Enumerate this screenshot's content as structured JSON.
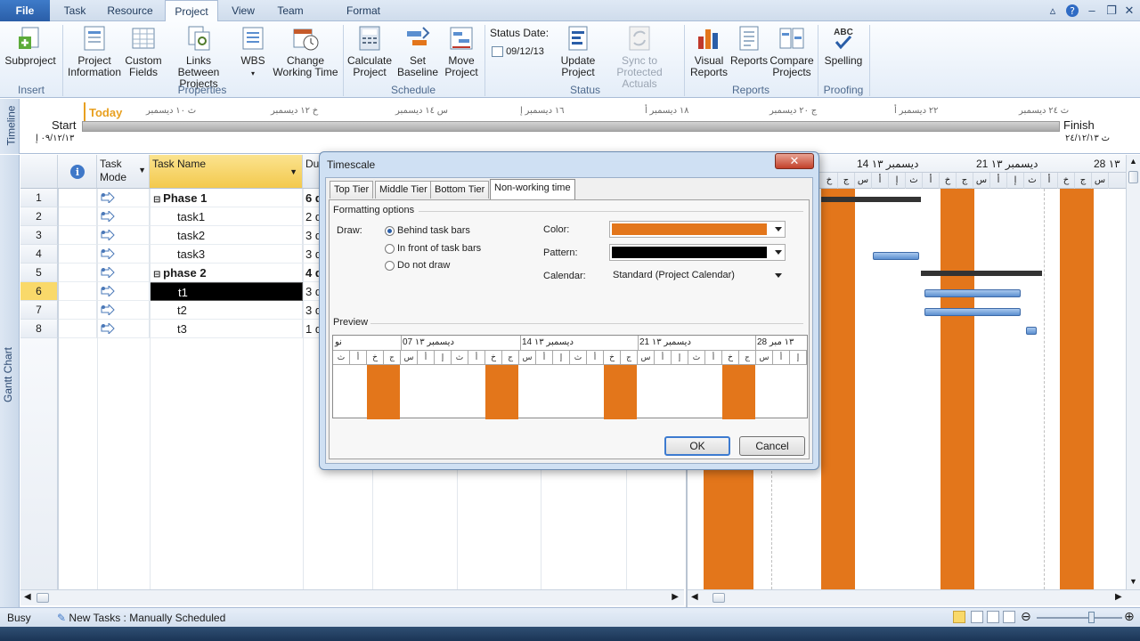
{
  "ribbon_tabs": [
    "File",
    "Task",
    "Resource",
    "Project",
    "View",
    "Team",
    "Format"
  ],
  "ribbon": {
    "insert": {
      "subproject": "Subproject",
      "group": "Insert"
    },
    "properties": {
      "project_info": "Project Information",
      "custom_fields": "Custom Fields",
      "links": "Links Between Projects",
      "wbs": "WBS",
      "change_working_time": "Change Working Time",
      "group": "Properties"
    },
    "schedule": {
      "calculate": "Calculate Project",
      "set_baseline": "Set Baseline",
      "move_project": "Move Project",
      "group": "Schedule"
    },
    "status": {
      "status_date_label": "Status Date:",
      "status_date": "09/12/13",
      "update_project": "Update Project",
      "sync": "Sync to Protected Actuals",
      "group": "Status"
    },
    "reports": {
      "visual_reports": "Visual Reports",
      "reports": "Reports",
      "compare": "Compare Projects",
      "group": "Reports"
    },
    "proofing": {
      "spelling": "Spelling",
      "group": "Proofing"
    }
  },
  "timeline": {
    "side_label": "Timeline",
    "today": "Today",
    "start_label": "Start",
    "start_date": "٠٩/١٢/١٣ إ",
    "finish_label": "Finish",
    "finish_date": "ث ٢٤/١٢/١٣",
    "ticks": [
      "ث ١٠ ديسمبر",
      "خ ١٢ ديسمبر",
      "س ١٤ ديسمبر",
      "١٦ ديسمبر إ",
      "١٨ ديسمبر أ",
      "ج ٢٠ ديسمبر",
      "٢٢ ديسمبر أ",
      "ث ٢٤ ديسمبر"
    ]
  },
  "gantt_side_label": "Gantt Chart",
  "table": {
    "headers": {
      "info": "i",
      "mode": "Task Mode",
      "name": "Task Name",
      "duration": "Du"
    },
    "rows": [
      {
        "id": "1",
        "name": "Phase 1",
        "dur": "6 d",
        "summary": true
      },
      {
        "id": "2",
        "name": "task1",
        "dur": "2 d",
        "summary": false
      },
      {
        "id": "3",
        "name": "task2",
        "dur": "3 d",
        "summary": false
      },
      {
        "id": "4",
        "name": "task3",
        "dur": "3 d",
        "summary": false
      },
      {
        "id": "5",
        "name": "phase 2",
        "dur": "4 d",
        "summary": true
      },
      {
        "id": "6",
        "name": "t1",
        "dur": "3 d",
        "summary": false,
        "selected": true
      },
      {
        "id": "7",
        "name": "t2",
        "dur": "3 d",
        "summary": false
      },
      {
        "id": "8",
        "name": "t3",
        "dur": "1 d",
        "summary": false
      }
    ]
  },
  "gantt": {
    "weeks": [
      "14 ديسمبر ١٣",
      "21 ديسمبر ١٣",
      "28 ١٣"
    ],
    "days": [
      "خ",
      "ج",
      "س",
      "أ",
      "إ",
      "ث",
      "أ",
      "خ",
      "ج",
      "س",
      "أ",
      "إ",
      "ث",
      "أ",
      "خ",
      "ج",
      "س"
    ]
  },
  "dialog": {
    "title": "Timescale",
    "close": "✕",
    "tabs": [
      "Top Tier",
      "Middle Tier",
      "Bottom Tier",
      "Non-working time"
    ],
    "formatting_options": "Formatting options",
    "draw_label": "Draw:",
    "draw_options": [
      "Behind task bars",
      "In front of task bars",
      "Do not draw"
    ],
    "color_label": "Color:",
    "color_value": "#e3761b",
    "pattern_label": "Pattern:",
    "calendar_label": "Calendar:",
    "calendar_value": "Standard (Project Calendar)",
    "preview_label": "Preview",
    "preview_weeks": [
      "نو",
      "07 ديسمبر ١٣",
      "14 ديسمبر ١٣",
      "21 ديسمبر ١٣",
      "28 ١٣ مبر"
    ],
    "preview_days": [
      "ث",
      "أ",
      "خ",
      "ج",
      "س",
      "أ",
      "إ",
      "ث",
      "أ",
      "خ",
      "ج",
      "س",
      "أ",
      "إ",
      "ث",
      "أ",
      "خ",
      "ج",
      "س",
      "أ",
      "إ",
      "ث",
      "أ",
      "خ",
      "ج",
      "س",
      "أ",
      "إ"
    ],
    "ok": "OK",
    "cancel": "Cancel"
  },
  "status_bar": {
    "mode": "Busy",
    "new_tasks": "New Tasks : Manually Scheduled"
  },
  "colors": {
    "nonworking": "#e3761b",
    "accent": "#2a5ea8"
  }
}
